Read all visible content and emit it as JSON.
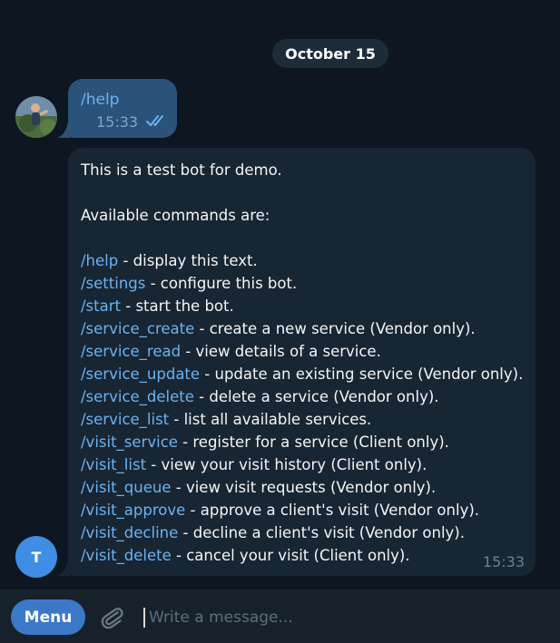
{
  "chat": {
    "date_label": "October 15",
    "outgoing": {
      "text": "/help",
      "time": "15:33"
    },
    "incoming": {
      "intro": "This is a test bot for demo.",
      "subheading": "Available commands are:",
      "commands": [
        {
          "cmd": "/help",
          "desc": " - display this text."
        },
        {
          "cmd": "/settings",
          "desc": " - configure this bot."
        },
        {
          "cmd": "/start",
          "desc": " - start the bot."
        },
        {
          "cmd": "/service_create",
          "desc": " - create a new service (Vendor only)."
        },
        {
          "cmd": "/service_read",
          "desc": " - view details of a service."
        },
        {
          "cmd": "/service_update",
          "desc": " - update an existing service (Vendor only)."
        },
        {
          "cmd": "/service_delete",
          "desc": " - delete a service (Vendor only)."
        },
        {
          "cmd": "/service_list",
          "desc": " - list all available services."
        },
        {
          "cmd": "/visit_service",
          "desc": " - register for a service (Client only)."
        },
        {
          "cmd": "/visit_list",
          "desc": " - view your visit history (Client only)."
        },
        {
          "cmd": "/visit_queue",
          "desc": " - view visit requests (Vendor only)."
        },
        {
          "cmd": "/visit_approve",
          "desc": " - approve a client's visit (Vendor only)."
        },
        {
          "cmd": "/visit_decline",
          "desc": " - decline a client's visit (Vendor only)."
        },
        {
          "cmd": "/visit_delete",
          "desc": " - cancel your visit (Client only)."
        }
      ],
      "time": "15:33",
      "avatar_letter": "T"
    }
  },
  "composer": {
    "menu_label": "Menu",
    "placeholder": "Write a message...",
    "value": ""
  },
  "icons": {
    "attach": "paperclip-icon",
    "read_receipt": "double-check-icon"
  },
  "colors": {
    "background": "#0e1621",
    "outgoing_bubble": "#2b5278",
    "incoming_bubble": "#182533",
    "link": "#6ab3f3",
    "accent": "#3b79c8"
  }
}
